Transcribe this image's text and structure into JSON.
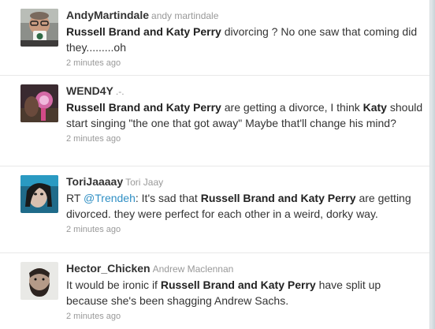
{
  "tweets": [
    {
      "screen_name": "AndyMartindale",
      "full_name": "andy martindale",
      "avatar": "avatar-man-with-mug",
      "segments": [
        {
          "text": "Russell Brand and Katy Perry",
          "bold": true
        },
        {
          "text": " divorcing ? No one saw that coming did they.........oh",
          "bold": false
        }
      ],
      "time": "2 minutes ago"
    },
    {
      "screen_name": "WEND4Y",
      "full_name": ".-.",
      "avatar": "avatar-pink-light",
      "segments": [
        {
          "text": "Russell Brand and Katy Perry",
          "bold": true
        },
        {
          "text": " are getting a divorce, I think ",
          "bold": false
        },
        {
          "text": "Katy",
          "bold": true
        },
        {
          "text": " should start singing \"the one that got away\" Maybe that'll change his mind?",
          "bold": false
        }
      ],
      "time": "2 minutes ago"
    },
    {
      "screen_name": "ToriJaaaay",
      "full_name": "Tori Jaay",
      "avatar": "avatar-girl-selfie",
      "segments": [
        {
          "text": "RT ",
          "bold": false
        },
        {
          "text": "@Trendeh",
          "bold": false,
          "mention": true
        },
        {
          "text": ": It's sad that ",
          "bold": false
        },
        {
          "text": "Russell Brand and Katy Perry",
          "bold": true
        },
        {
          "text": " are getting divorced. they were perfect for each other in a weird, dorky way.",
          "bold": false
        }
      ],
      "time": "2 minutes ago"
    },
    {
      "screen_name": "Hector_Chicken",
      "full_name": "Andrew Maclennan",
      "avatar": "avatar-bearded-man",
      "segments": [
        {
          "text": "It would be ironic if ",
          "bold": false
        },
        {
          "text": "Russell Brand and Katy Perry",
          "bold": true
        },
        {
          "text": " have split up because she's been shagging Andrew Sachs.",
          "bold": false
        }
      ],
      "time": "2 minutes ago"
    }
  ],
  "colors": {
    "screen_name": "#333333",
    "full_name": "#999999",
    "text": "#333333",
    "mention": "#2f8fc4",
    "timestamp": "#999999"
  }
}
